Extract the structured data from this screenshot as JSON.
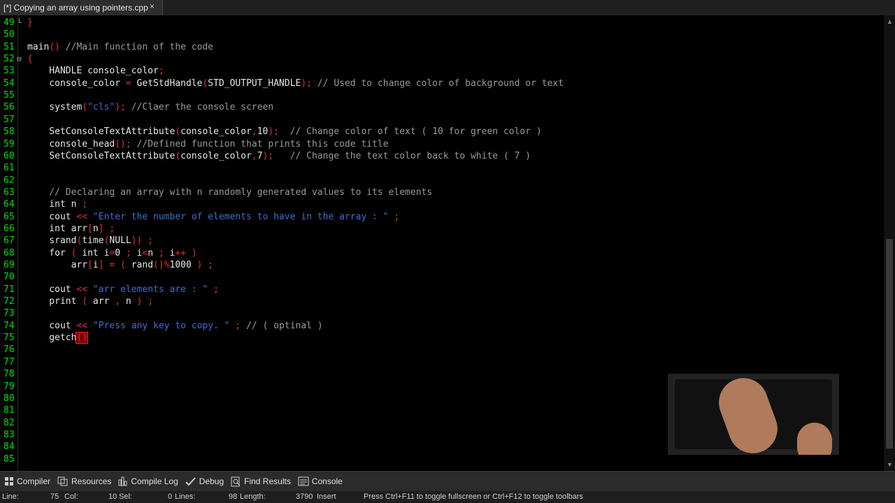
{
  "tab": {
    "title": "[*] Copying an array using pointers.cpp",
    "close": "×"
  },
  "editor": {
    "lines": [
      {
        "num": "49",
        "fold": "└",
        "tokens": [
          [
            "p",
            "}"
          ]
        ]
      },
      {
        "num": "50",
        "tokens": []
      },
      {
        "num": "51",
        "tokens": [
          [
            "n",
            "main"
          ],
          [
            "p",
            "()"
          ],
          [
            "c",
            " //Main function of the code"
          ]
        ]
      },
      {
        "num": "52",
        "fold": "⊟",
        "tokens": [
          [
            "p",
            "{"
          ]
        ]
      },
      {
        "num": "53",
        "tokens": [
          [
            "n",
            "    HANDLE console_color"
          ],
          [
            "p",
            ";"
          ]
        ]
      },
      {
        "num": "54",
        "tokens": [
          [
            "n",
            "    console_color "
          ],
          [
            "p",
            "="
          ],
          [
            "n",
            " GetStdHandle"
          ],
          [
            "p",
            "("
          ],
          [
            "n",
            "STD_OUTPUT_HANDLE"
          ],
          [
            "p",
            ");"
          ],
          [
            "c",
            " // Used to change color of background or text"
          ]
        ]
      },
      {
        "num": "55",
        "tokens": []
      },
      {
        "num": "56",
        "tokens": [
          [
            "n",
            "    system"
          ],
          [
            "p",
            "("
          ],
          [
            "s",
            "\"cls\""
          ],
          [
            "p",
            ");"
          ],
          [
            "c",
            " //Claer the console screen"
          ]
        ]
      },
      {
        "num": "57",
        "tokens": []
      },
      {
        "num": "58",
        "tokens": [
          [
            "n",
            "    SetConsoleTextAttribute"
          ],
          [
            "p",
            "("
          ],
          [
            "n",
            "console_color"
          ],
          [
            "p",
            ","
          ],
          [
            "n",
            "10"
          ],
          [
            "p",
            ");"
          ],
          [
            "c",
            "  // Change color of text ( 10 for green color )"
          ]
        ]
      },
      {
        "num": "59",
        "tokens": [
          [
            "n",
            "    console_head"
          ],
          [
            "p",
            "();"
          ],
          [
            "c",
            " //Defined function that prints this code title"
          ]
        ]
      },
      {
        "num": "60",
        "tokens": [
          [
            "n",
            "    SetConsoleTextAttribute"
          ],
          [
            "p",
            "("
          ],
          [
            "n",
            "console_color"
          ],
          [
            "p",
            ","
          ],
          [
            "n",
            "7"
          ],
          [
            "p",
            ");"
          ],
          [
            "c",
            "   // Change the text color back to white ( 7 )"
          ]
        ]
      },
      {
        "num": "61",
        "tokens": []
      },
      {
        "num": "62",
        "tokens": []
      },
      {
        "num": "63",
        "tokens": [
          [
            "c",
            "    // Declaring an array with n randomly generated values to its elements"
          ]
        ]
      },
      {
        "num": "64",
        "tokens": [
          [
            "n",
            "    int n "
          ],
          [
            "p",
            ";"
          ]
        ]
      },
      {
        "num": "65",
        "tokens": [
          [
            "n",
            "    cout "
          ],
          [
            "p",
            "<<"
          ],
          [
            "s",
            " \"Enter the number of elements to have in the array : \""
          ],
          [
            "p",
            " ;"
          ]
        ]
      },
      {
        "num": "66",
        "tokens": [
          [
            "n",
            "    int arr"
          ],
          [
            "p",
            "["
          ],
          [
            "n",
            "n"
          ],
          [
            "p",
            "]"
          ],
          [
            "p",
            " ;"
          ]
        ]
      },
      {
        "num": "67",
        "tokens": [
          [
            "n",
            "    srand"
          ],
          [
            "p",
            "("
          ],
          [
            "n",
            "time"
          ],
          [
            "p",
            "("
          ],
          [
            "n",
            "NULL"
          ],
          [
            "p",
            "))"
          ],
          [
            "p",
            " ;"
          ]
        ]
      },
      {
        "num": "68",
        "tokens": [
          [
            "n",
            "    for "
          ],
          [
            "p",
            "("
          ],
          [
            "n",
            " int i"
          ],
          [
            "p",
            "="
          ],
          [
            "n",
            "0 "
          ],
          [
            "p",
            ";"
          ],
          [
            "n",
            " i"
          ],
          [
            "p",
            "<"
          ],
          [
            "n",
            "n "
          ],
          [
            "p",
            ";"
          ],
          [
            "n",
            " i"
          ],
          [
            "p",
            "++"
          ],
          [
            "n",
            " "
          ],
          [
            "p",
            ")"
          ]
        ]
      },
      {
        "num": "69",
        "tokens": [
          [
            "n",
            "        arr"
          ],
          [
            "p",
            "["
          ],
          [
            "n",
            "i"
          ],
          [
            "p",
            "]"
          ],
          [
            "n",
            " "
          ],
          [
            "p",
            "="
          ],
          [
            "n",
            " "
          ],
          [
            "p",
            "("
          ],
          [
            "n",
            " rand"
          ],
          [
            "p",
            "()"
          ],
          [
            "p",
            "%"
          ],
          [
            "n",
            "1000 "
          ],
          [
            "p",
            ")"
          ],
          [
            "p",
            " ;"
          ]
        ]
      },
      {
        "num": "70",
        "tokens": []
      },
      {
        "num": "71",
        "tokens": [
          [
            "n",
            "    cout "
          ],
          [
            "p",
            "<<"
          ],
          [
            "s",
            " \"arr elements are : \""
          ],
          [
            "p",
            " ;"
          ]
        ]
      },
      {
        "num": "72",
        "tokens": [
          [
            "n",
            "    print "
          ],
          [
            "p",
            "("
          ],
          [
            "n",
            " arr "
          ],
          [
            "p",
            ","
          ],
          [
            "n",
            " n "
          ],
          [
            "p",
            ")"
          ],
          [
            "p",
            " ;"
          ]
        ]
      },
      {
        "num": "73",
        "tokens": []
      },
      {
        "num": "74",
        "tokens": [
          [
            "n",
            "    cout "
          ],
          [
            "p",
            "<<"
          ],
          [
            "s",
            " \"Press any key to copy. \""
          ],
          [
            "p",
            " ;"
          ],
          [
            "c",
            " // ( optinal )"
          ]
        ]
      },
      {
        "num": "75",
        "tokens": [
          [
            "n",
            "    getch"
          ],
          [
            "cur",
            "()"
          ]
        ]
      },
      {
        "num": "76",
        "tokens": []
      },
      {
        "num": "77",
        "tokens": []
      },
      {
        "num": "78",
        "tokens": []
      },
      {
        "num": "79",
        "tokens": []
      },
      {
        "num": "80",
        "tokens": []
      },
      {
        "num": "81",
        "tokens": []
      },
      {
        "num": "82",
        "tokens": []
      },
      {
        "num": "83",
        "tokens": []
      },
      {
        "num": "84",
        "tokens": []
      },
      {
        "num": "85",
        "tokens": []
      }
    ]
  },
  "bottom_tabs": [
    {
      "label": "Compiler",
      "icon": "compiler-grid-icon"
    },
    {
      "label": "Resources",
      "icon": "resources-icon"
    },
    {
      "label": "Compile Log",
      "icon": "compile-log-icon"
    },
    {
      "label": "Debug",
      "icon": "checkmark-icon"
    },
    {
      "label": "Find Results",
      "icon": "find-results-icon"
    },
    {
      "label": "Console",
      "icon": "console-icon"
    }
  ],
  "status": {
    "line_label": "Line:",
    "line_value": "75",
    "col_label": "Col:",
    "col_value": "10",
    "sel_label": "Sel:",
    "sel_value": "0",
    "lines_label": "Lines:",
    "lines_value": "98",
    "length_label": "Length:",
    "length_value": "3790",
    "mode": "Insert",
    "hint": "Press Ctrl+F11 to toggle fullscreen or Ctrl+F12 to toggle toolbars"
  },
  "colors": {
    "line_numbers": "#00e000",
    "comment": "#9a9a9a",
    "string": "#3c6fd0",
    "punct": "#e03030",
    "text": "#e6e6e6"
  }
}
